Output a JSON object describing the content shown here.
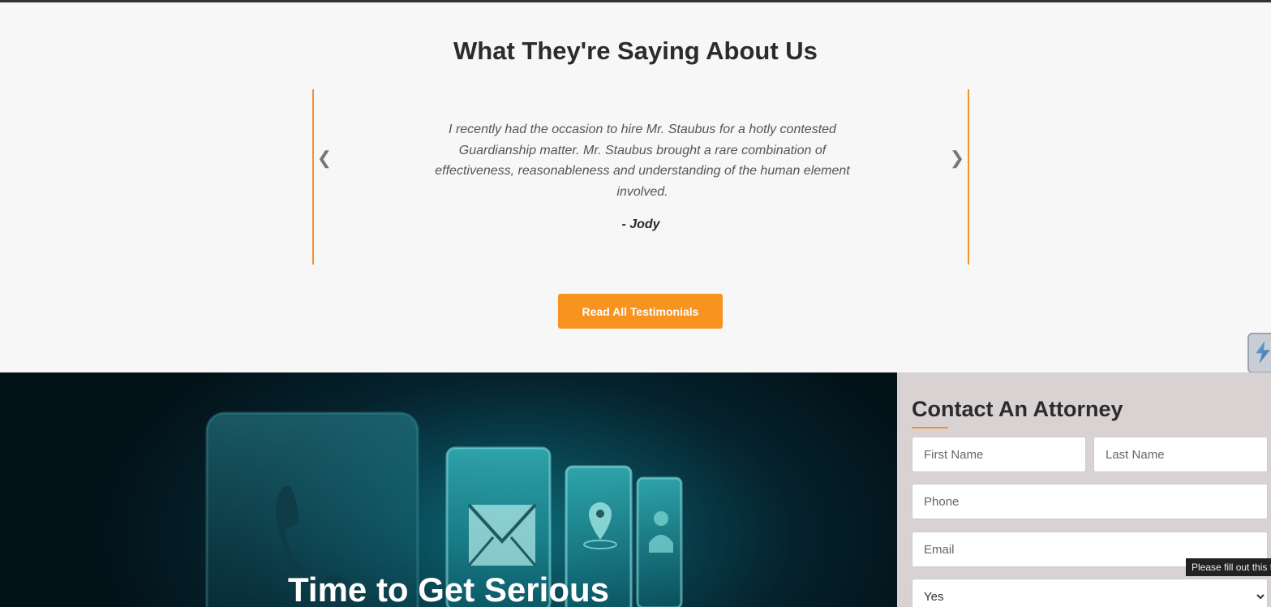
{
  "testimonials": {
    "heading": "What They're Saying About Us",
    "prev_arrow": "❮",
    "next_arrow": "❯",
    "quote": "I recently had the occasion to hire Mr. Staubus for a hotly contested Guardianship matter. Mr. Staubus brought a rare combination of effectiveness, reasonableness and understanding of the human element involved.",
    "author": "- Jody",
    "button_label": "Read All Testimonials"
  },
  "hero": {
    "heading": "Time to Get Serious",
    "icons": [
      "phone-icon",
      "envelope-icon",
      "location-pin-icon",
      "contacts-icon"
    ]
  },
  "contact": {
    "heading": "Contact An Attorney",
    "first_name_placeholder": "First Name",
    "last_name_placeholder": "Last Name",
    "phone_placeholder": "Phone",
    "email_placeholder": "Email",
    "select_value": "Yes"
  },
  "tooltip": "Please fill out this field.",
  "colors": {
    "accent": "#f7931e",
    "heading": "#2b2b2b",
    "contact_bg": "#d9d2d2"
  }
}
